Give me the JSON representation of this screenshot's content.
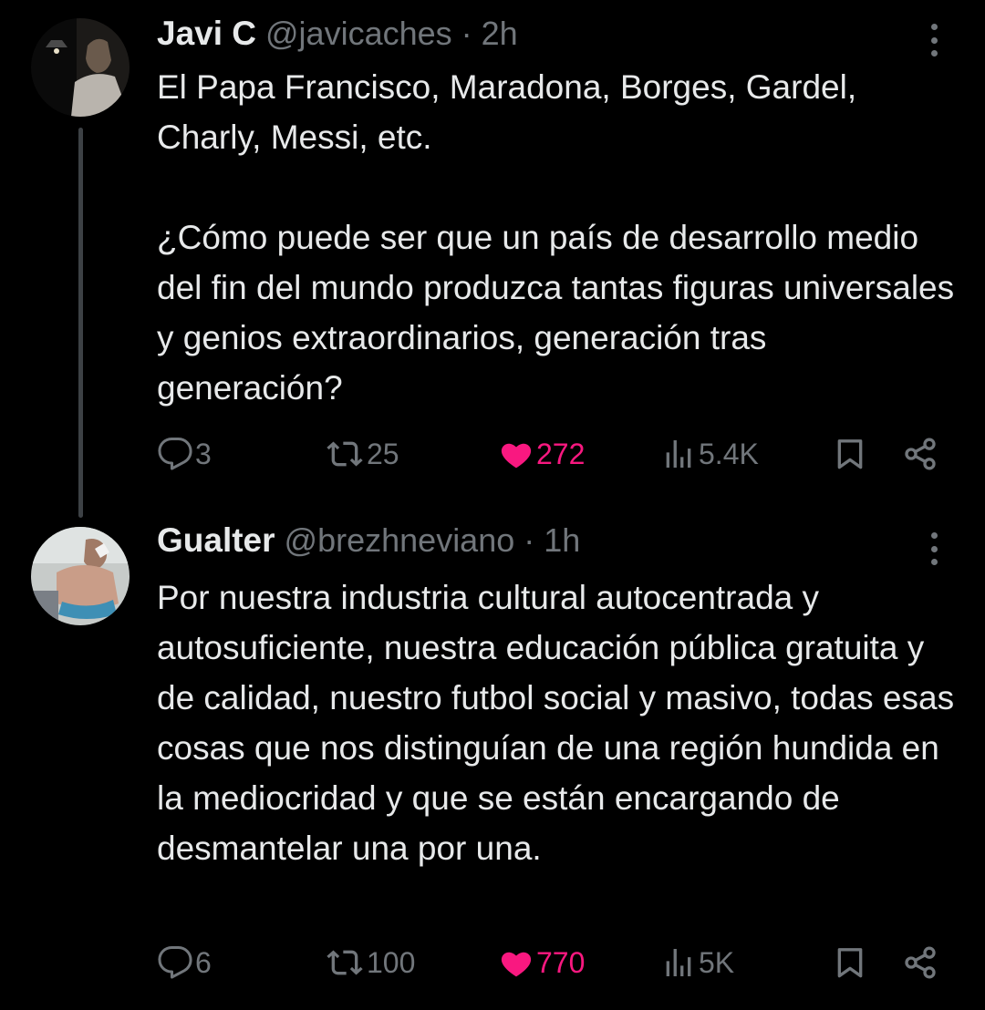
{
  "tweets": [
    {
      "display_name": "Javi C",
      "handle": "@javicaches",
      "separator": "·",
      "time": "2h",
      "text": "El Papa Francisco, Maradona, Borges, Gardel, Charly, Messi, etc.\n\n¿Cómo puede ser que un país de desarrollo medio del fin del mundo produzca tantas figuras universales y genios extraordinarios, generación tras generación?",
      "replies": "3",
      "retweets": "25",
      "likes": "272",
      "views": "5.4K",
      "liked": true
    },
    {
      "display_name": "Gualter",
      "handle": "@brezhneviano",
      "separator": "·",
      "time": "1h",
      "text": "Por nuestra industria cultural autocentrada y autosuficiente, nuestra educación pública gratuita y de calidad, nuestro futbol social y masivo, todas esas cosas que nos distinguían de una región hundida en la mediocridad y que se están encargando de desmantelar una por una.",
      "replies": "6",
      "retweets": "100",
      "likes": "770",
      "views": "5K",
      "liked": true
    }
  ],
  "colors": {
    "background": "#000000",
    "text": "#e7e9ea",
    "secondary": "#71767b",
    "like": "#f91880",
    "thread_line": "#3d4145"
  },
  "icons": [
    "reply-icon",
    "retweet-icon",
    "heart-icon",
    "views-icon",
    "bookmark-icon",
    "share-icon",
    "more-icon"
  ]
}
